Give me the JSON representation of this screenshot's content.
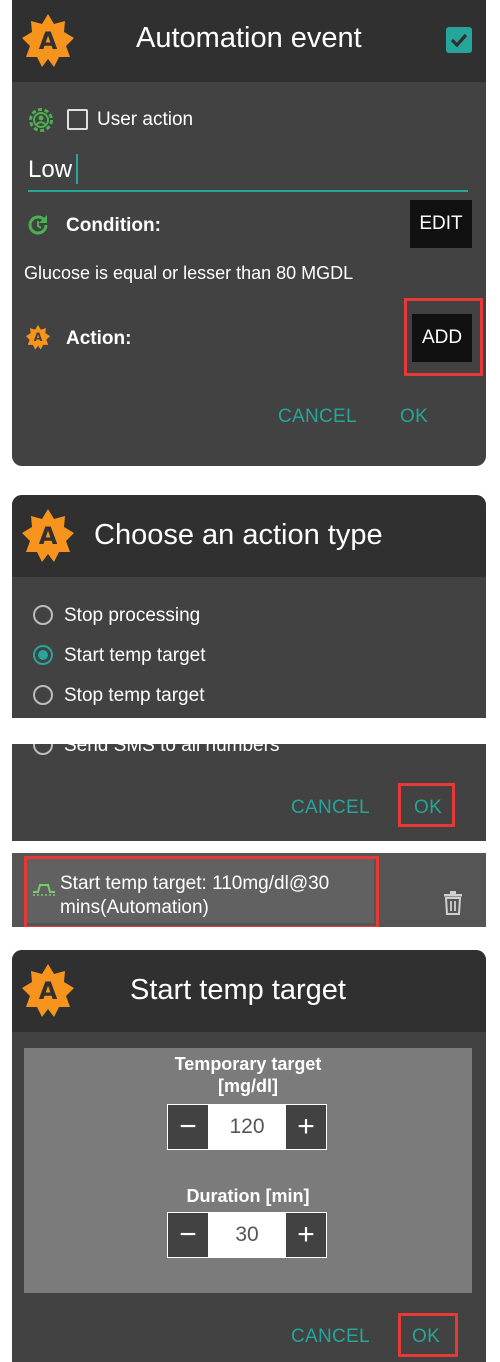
{
  "colors": {
    "accent": "#26a69a",
    "highlight": "#e53935",
    "logo": "#f7941d",
    "condition_icon": "#4caf50"
  },
  "event_dialog": {
    "title": "Automation event",
    "user_action_label": "User action",
    "user_action_checked": false,
    "title_checkbox_checked": true,
    "name_value": "Low",
    "condition_label": "Condition:",
    "edit_label": "EDIT",
    "condition_text": "Glucose is equal or lesser than 80 MGDL",
    "action_label": "Action:",
    "add_label": "ADD",
    "cancel_label": "CANCEL",
    "ok_label": "OK",
    "logo_letter": "A"
  },
  "action_type_dialog": {
    "title": "Choose an action type",
    "options": [
      {
        "label": "Stop processing",
        "selected": false
      },
      {
        "label": "Start temp target",
        "selected": true
      },
      {
        "label": "Stop temp target",
        "selected": false
      },
      {
        "label": "Send SMS to all numbers",
        "selected": false
      }
    ],
    "cancel_label": "CANCEL",
    "ok_label": "OK",
    "logo_letter": "A"
  },
  "action_item": {
    "text_line1": "Start temp target: 110mg/dl@30",
    "text_line2": "mins(Automation)",
    "icon": "temp-target-icon",
    "delete_icon": "trash-icon"
  },
  "temp_target_dialog": {
    "title": "Start temp target",
    "target_label_line1": "Temporary target",
    "target_label_line2": "[mg/dl]",
    "target_value": "120",
    "duration_label": "Duration [min]",
    "duration_value": "30",
    "minus_symbol": "−",
    "plus_symbol": "+",
    "cancel_label": "CANCEL",
    "ok_label": "OK",
    "logo_letter": "A"
  }
}
